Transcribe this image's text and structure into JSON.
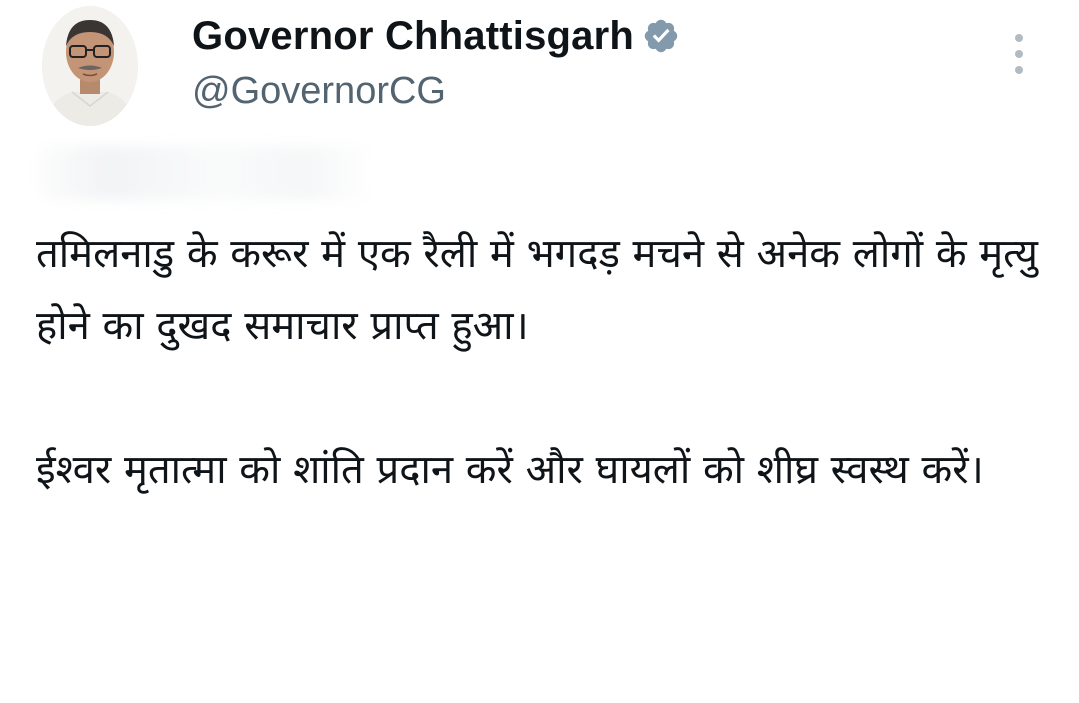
{
  "author": {
    "display_name": "Governor Chhattisgarh",
    "handle": "@GovernorCG",
    "verified": true,
    "avatar_icon": "profile-photo",
    "badge_color": "#829aab"
  },
  "menu": {
    "more_icon": "more-vertical-icon"
  },
  "tweet": {
    "paragraphs": [
      "तमिलनाडु के करूर में एक रैली में भगदड़ मचने से अनेक लोगों के मृत्यु होने का दुखद समाचार प्राप्त हुआ।",
      "ईश्वर मृतात्मा को शांति प्रदान करें और घायलों को शीघ्र स्वस्थ करें।"
    ]
  },
  "colors": {
    "text_primary": "#0f1419",
    "text_secondary": "#536471",
    "background": "#ffffff"
  }
}
